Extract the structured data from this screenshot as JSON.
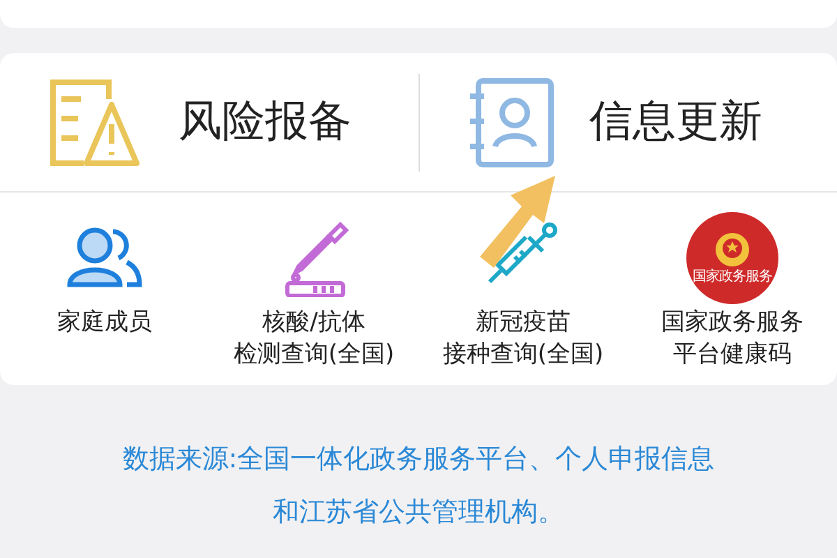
{
  "main_actions": [
    {
      "kind": "report",
      "label": "风险报备"
    },
    {
      "kind": "update",
      "label": "信息更新"
    }
  ],
  "services": [
    {
      "kind": "family",
      "lines": [
        "家庭成员"
      ]
    },
    {
      "kind": "test",
      "lines": [
        "核酸/抗体",
        "检测查询(全国)"
      ]
    },
    {
      "kind": "vaccine",
      "lines": [
        "新冠疫苗",
        "接种查询(全国)"
      ]
    },
    {
      "kind": "gov",
      "logo_text": "国家政务服务",
      "lines": [
        "国家政务服务",
        "平台健康码"
      ]
    }
  ],
  "source_note": [
    "数据来源:全国一体化政务服务平台、个人申报信息",
    "和江苏省公共管理机构。"
  ]
}
